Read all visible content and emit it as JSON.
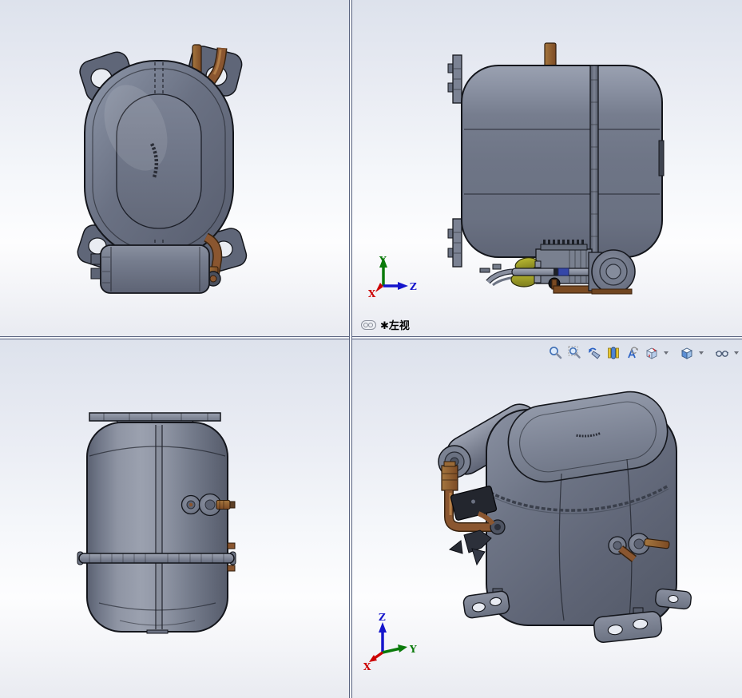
{
  "viewports": {
    "top_left": {
      "content": "compressor-top-view"
    },
    "top_right": {
      "content": "compressor-left-view",
      "view_label": "✱左视",
      "view_label_icon": "linked-view-icon",
      "triad": {
        "up_label": "Y",
        "right_label": "Z",
        "origin_label": "X"
      }
    },
    "bottom_left": {
      "content": "compressor-front-view"
    },
    "bottom_right": {
      "content": "compressor-isometric-view",
      "triad": {
        "up_label": "Z",
        "right_label": "Y",
        "origin_label": "X"
      },
      "toolbar_icons": [
        "zoom-to-fit",
        "zoom-to-area",
        "previous-view",
        "section-view",
        "annotation-views",
        "view-orientation",
        "display-style",
        "hide-show-items"
      ],
      "toolbar_dropdowns": [
        "view-orientation",
        "display-style",
        "hide-show-items"
      ]
    }
  },
  "colors": {
    "background_top": "#dde2ec",
    "background_middle": "#fbfcfd",
    "background_bottom": "#e9ebf1",
    "viewport_divider": "#5a6480",
    "steel_body": "#6e7586",
    "steel_light": "#9aa0ae",
    "steel_dark": "#565c6b",
    "edge_line": "#14161c",
    "copper_pipe": "#8a5630",
    "yellow_component": "#a8a820",
    "blue_band": "#3547a8",
    "brown_bracket": "#7a4a22",
    "axis_x": "#cc0000",
    "axis_y": "#0a7a0a",
    "axis_z": "#1515cc",
    "label_text": "#000000"
  }
}
